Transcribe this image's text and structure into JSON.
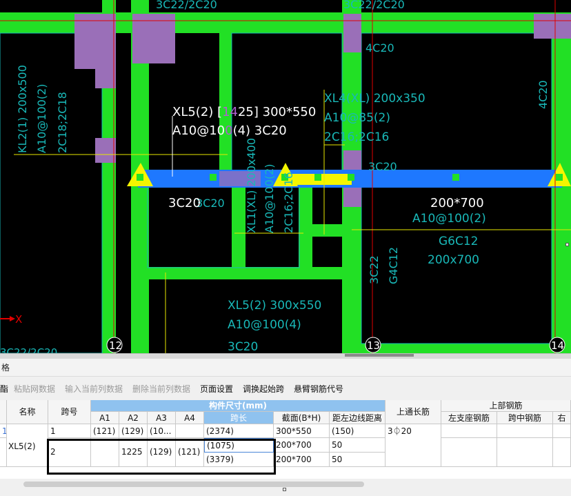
{
  "cad": {
    "labels": {
      "top_left_cut": "3C22/2C20",
      "top_mid_cut": "3C22/2C20",
      "kl2": "KL2(1) 200x500",
      "kl2_stirrup": "A10@100(2)",
      "kl2_bars": "2C18;2C18",
      "xl5_title_a": "XL5(2) [",
      "xl5_title_hl": "14",
      "xl5_title_b": "25] 300*550",
      "xl5_stirrup_a": "A10@10",
      "xl5_stirrup_hl": "0",
      "xl5_stirrup_b": "(4) 3C20",
      "xl4": "XL4(XL) 200x350",
      "xl4_stirrup": "A10@85(2)",
      "xl4_bars": "2C16;2C16",
      "c4c20_a": "4C20",
      "c4c20_b": "4C20",
      "c3c20_right": "3C20",
      "xl1_vertical": "XL1(XL) 200x400",
      "xl1_stirrup": "A10@100(2)",
      "xl1_bars": "2C16;2C16",
      "below_3c20_a": "3C20",
      "below_3c20_b": "3C20",
      "section_200x700_top": "200*700",
      "stirrup_right": "A10@100(2)",
      "g6c12": "G6C12",
      "size_200x700": "200x700",
      "col_3c22": "3C22",
      "col_g4c12": "G4C12",
      "xl5_lower": "XL5(2) 300x550",
      "xl5_lower_stirrup": "A10@100(4)",
      "xl5_lower_bars": "3C20",
      "axis_x": "X",
      "bottom_left_cut": "3C22/2C20",
      "axis_12": "12",
      "axis_13": "13",
      "axis_14": "14"
    }
  },
  "panel": {
    "title": "格",
    "toolbar": {
      "partial": "酯",
      "paste": "粘贴网数据",
      "insert_col": "输入当前列数据",
      "delete_col": "删除当前列数据",
      "page_setup": "页面设置",
      "adjust_span": "调换起始跨",
      "cantilever": "悬臂钢筋代号"
    },
    "headers": {
      "name": "名称",
      "span_no": "跨号",
      "dims_group": "构件尺寸(mm)",
      "a1": "A1",
      "a2": "A2",
      "a3": "A3",
      "a4": "A4",
      "span_len": "跨长",
      "section": "截面(B*H)",
      "edge_dist": "距左边线距离",
      "top_through": "上通长筋",
      "top_rebar_group": "上部钢筋",
      "left_support": "左支座钢筋",
      "mid_span": "跨中钢筋",
      "right_cut": "右"
    },
    "rows": [
      {
        "name": "",
        "span": "1",
        "a1": "(121)",
        "a2": "(129)",
        "a3": "(10...",
        "a4": "",
        "span_len": "(2374)",
        "section": "300*550",
        "edge": "(150)",
        "top_through": "3⏀20"
      },
      {
        "name": "XL5(2)",
        "span": "2",
        "a1": "",
        "a2": "1225",
        "a3": "(129)",
        "a4": "(121)",
        "span_len": "(1075)",
        "section": "200*700",
        "edge": "50"
      },
      {
        "span_len": "(3379)",
        "section": "200*700",
        "edge": "50"
      }
    ],
    "left_edge_mark": "1"
  },
  "colors": {
    "canvas_bg": "#000000",
    "wall_green": "#22e025",
    "column_purple": "#9a6fb8",
    "beam_blue": "#1e78ff",
    "beam_yellow": "#f5f500",
    "cad_cyan": "#19b8b8",
    "cad_white": "#ffffff",
    "red_axis": "#e00000",
    "header_blue": "#8fc2ef"
  }
}
